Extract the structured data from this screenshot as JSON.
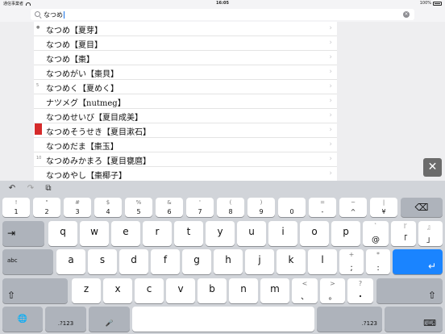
{
  "status": {
    "carrier": "通信事業者",
    "time": "16:05",
    "battery": "100%"
  },
  "search": {
    "value": "なつめ",
    "clear_glyph": "×"
  },
  "results": [
    {
      "text": "なつめ【夏芽】",
      "mark": "●"
    },
    {
      "text": "なつめ【夏目】",
      "mark": ""
    },
    {
      "text": "なつめ【棗】",
      "mark": ""
    },
    {
      "text": "なつめがい【棗貝】",
      "mark": ""
    },
    {
      "text": "なつめく【夏めく】",
      "mark": "5"
    },
    {
      "text": "ナツメグ【nutmeg】",
      "mark": ""
    },
    {
      "text": "なつめせいび【夏目成美】",
      "mark": ""
    },
    {
      "text": "なつめそうせき【夏目漱石】",
      "mark": "",
      "bookmarked": true
    },
    {
      "text": "なつめだま【棗玉】",
      "mark": ""
    },
    {
      "text": "なつめみかまろ【夏目甕麿】",
      "mark": "10"
    },
    {
      "text": "なつめやし【棗椰子】",
      "mark": ""
    }
  ],
  "chevron": "›",
  "close_glyph": "✕",
  "toolbar": {
    "undo": "↶",
    "redo": "↷",
    "paste": "⧉"
  },
  "keys": {
    "num": [
      {
        "sub": "!",
        "main": "1"
      },
      {
        "sub": "\"",
        "main": "2"
      },
      {
        "sub": "#",
        "main": "3"
      },
      {
        "sub": "$",
        "main": "4"
      },
      {
        "sub": "%",
        "main": "5"
      },
      {
        "sub": "&",
        "main": "6"
      },
      {
        "sub": "'",
        "main": "7"
      },
      {
        "sub": "(",
        "main": "8"
      },
      {
        "sub": ")",
        "main": "9"
      },
      {
        "sub": "",
        "main": "0"
      },
      {
        "sub": "=",
        "main": "-"
      },
      {
        "sub": "~",
        "main": "^"
      },
      {
        "sub": "|",
        "main": "¥"
      }
    ],
    "backspace": "⌫",
    "tab": "⇥",
    "row1": [
      "q",
      "w",
      "e",
      "r",
      "t",
      "y",
      "u",
      "i",
      "o",
      "p"
    ],
    "row1_sym": [
      {
        "sub": "`",
        "main": "@"
      },
      {
        "sub": "『",
        "main": "「"
      },
      {
        "sub": "』",
        "main": "」"
      }
    ],
    "abc": "abc",
    "row2": [
      "a",
      "s",
      "d",
      "f",
      "g",
      "h",
      "j",
      "k",
      "l"
    ],
    "row2_sym": [
      {
        "sub": "+",
        "main": ";"
      },
      {
        "sub": "*",
        "main": ":"
      }
    ],
    "enter": "↵",
    "shift": "⇧",
    "row3": [
      "z",
      "x",
      "c",
      "v",
      "b",
      "n",
      "m"
    ],
    "row3_sym": [
      {
        "sub": "<",
        "main": "、"
      },
      {
        "sub": ">",
        "main": "。"
      },
      {
        "sub": "?",
        "main": "・"
      }
    ],
    "globe": "🌐",
    "num_switch": ".?123",
    "mic": "🎤",
    "space": "",
    "hide": "⌨"
  }
}
